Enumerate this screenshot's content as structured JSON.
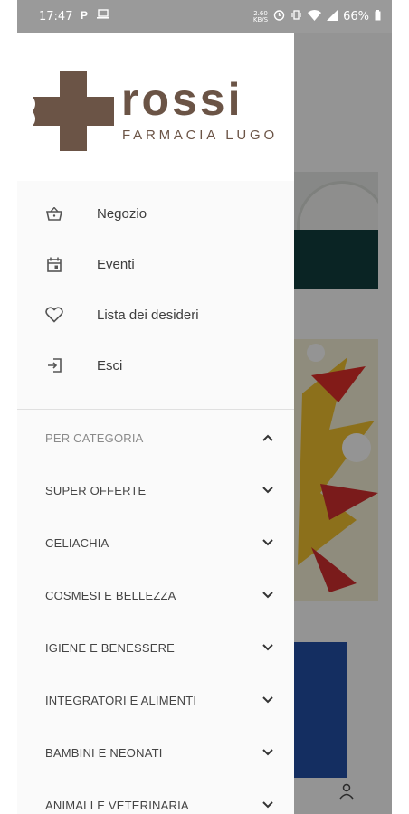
{
  "status_bar": {
    "time": "17:47",
    "network_speed_value": "2.60",
    "network_speed_unit": "KB/S",
    "battery": "66%"
  },
  "brand": {
    "name": "rossi",
    "subtitle": "FARMACIA  LUGO",
    "color": "#6b5446"
  },
  "menu": {
    "items": [
      {
        "label": "Negozio",
        "icon": "basket-icon"
      },
      {
        "label": "Eventi",
        "icon": "calendar-icon"
      },
      {
        "label": "Lista dei desideri",
        "icon": "heart-icon"
      },
      {
        "label": "Esci",
        "icon": "logout-icon"
      }
    ]
  },
  "categories": {
    "header": "PER CATEGORIA",
    "items": [
      "SUPER OFFERTE",
      "CELIACHIA",
      "COSMESI E BELLEZZA",
      "IGIENE E BENESSERE",
      "INTEGRATORI E ALIMENTI",
      "BAMBINI E NEONATI",
      "ANIMALI E VETERINARIA"
    ]
  },
  "colors": {
    "text": "#3d3d3d",
    "icon": "#555555",
    "drawer_bg": "#fafafa"
  }
}
